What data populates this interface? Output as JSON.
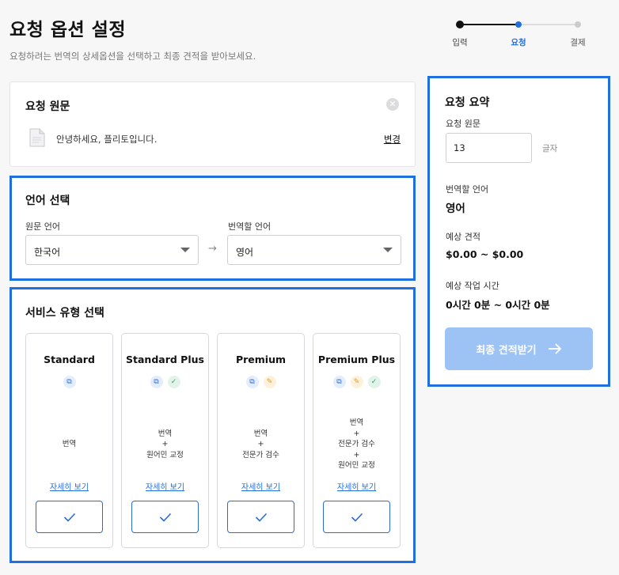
{
  "page": {
    "title": "요청 옵션 설정",
    "subtitle": "요청하려는 번역의 상세옵션을 선택하고 최종 견적을 받아보세요."
  },
  "stepper": {
    "steps": [
      {
        "label": "입력",
        "state": "done"
      },
      {
        "label": "요청",
        "state": "current"
      },
      {
        "label": "결제",
        "state": "upcoming"
      }
    ]
  },
  "origin": {
    "heading": "요청 원문",
    "close_icon": "close-icon",
    "file_name": "안녕하세요, 플리토입니다.",
    "change_label": "변경"
  },
  "language": {
    "heading": "언어 선택",
    "source_label": "원문 언어",
    "source_value": "한국어",
    "arrow": "→",
    "target_label": "번역할 언어",
    "target_value": "영어"
  },
  "service": {
    "heading": "서비스 유형 선택",
    "plans": [
      {
        "name": "Standard",
        "icons": [
          "translate"
        ],
        "desc": [
          "번역"
        ],
        "detail": "자세히 보기"
      },
      {
        "name": "Standard Plus",
        "icons": [
          "translate",
          "native"
        ],
        "desc": [
          "번역",
          "+",
          "원어민 교정"
        ],
        "detail": "자세히 보기"
      },
      {
        "name": "Premium",
        "icons": [
          "translate",
          "review"
        ],
        "desc": [
          "번역",
          "+",
          "전문가 검수"
        ],
        "detail": "자세히 보기"
      },
      {
        "name": "Premium Plus",
        "icons": [
          "translate",
          "review",
          "native"
        ],
        "desc": [
          "번역",
          "+",
          "전문가 검수",
          "+",
          "원어민 교정"
        ],
        "detail": "자세히 보기"
      }
    ]
  },
  "summary": {
    "heading": "요청 요약",
    "origin_label": "요청 원문",
    "char_count": "13",
    "char_unit": "글자",
    "target_label": "번역할 언어",
    "target_value": "영어",
    "estimate_label": "예상 견적",
    "estimate_value": "$0.00 ~ $0.00",
    "time_label": "예상 작업 시간",
    "time_value": "0시간 0분 ~ 0시간 0분",
    "submit_label": "최종 견적받기"
  },
  "colors": {
    "accent": "#1f6fe0",
    "button_disabled": "#9dc3f5",
    "step_done": "#111111",
    "step_current": "#1f6fe0",
    "step_upcoming": "#cccccc"
  }
}
